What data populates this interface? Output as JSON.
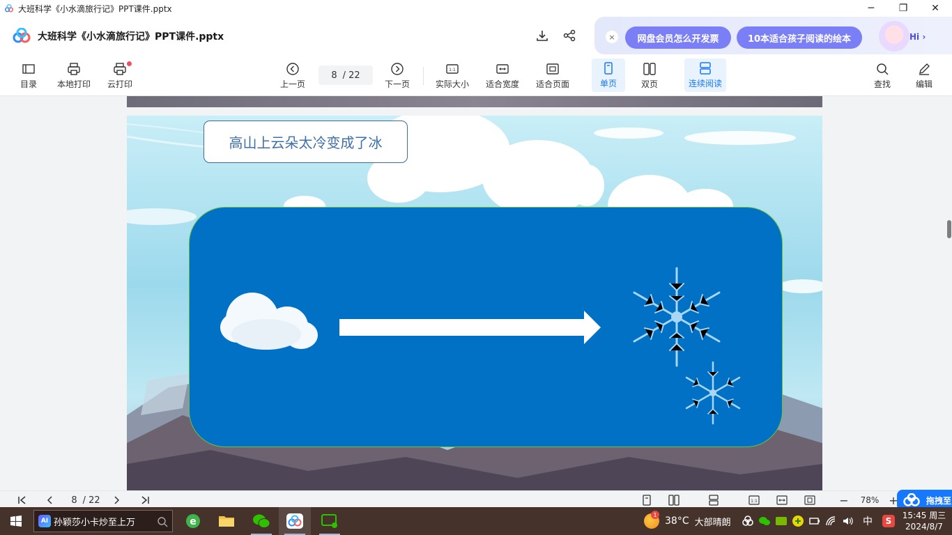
{
  "window": {
    "title": "大班科学《小水滴旅行记》PPT课件.pptx",
    "controls": {
      "minimize": "─",
      "maximize": "❐",
      "close": "✕"
    }
  },
  "header": {
    "doc_title": "大班科学《小水滴旅行记》PPT课件.pptx",
    "icons": [
      "download-icon",
      "share-icon"
    ]
  },
  "promo": {
    "close": "×",
    "pill1": "网盘会员怎么开发票",
    "pill2": "10本适合孩子阅读的绘本",
    "hi": "Hi ›"
  },
  "toolbar": {
    "toc": "目录",
    "local_print": "本地打印",
    "cloud_print": "云打印",
    "prev": "上一页",
    "current_page": "8",
    "total_pages": "/ 22",
    "next": "下一页",
    "actual_size": "实际大小",
    "fit_width": "适合宽度",
    "fit_page": "适合页面",
    "single": "单页",
    "double": "双页",
    "continuous": "连续阅读",
    "find": "查找",
    "edit": "编辑"
  },
  "slide": {
    "caption": "高山上云朵太冷变成了冰",
    "colors": {
      "panel": "#0071c5",
      "panel_border": "#6cbf3f",
      "caption_text": "#3f6fa8"
    }
  },
  "bottombar": {
    "current_page": "8",
    "total_pages": "/ 22",
    "zoom": "78%",
    "zoom_out": "−",
    "zoom_in": "+",
    "float_label": "拖拽至"
  },
  "taskbar": {
    "search_text": "孙颖莎小卡炒至上万",
    "weather_temp": "38°C",
    "weather_desc": "大部晴朗",
    "weather_badge": "1",
    "ime": "中",
    "time": "15:45 周三",
    "date": "2024/8/7"
  }
}
